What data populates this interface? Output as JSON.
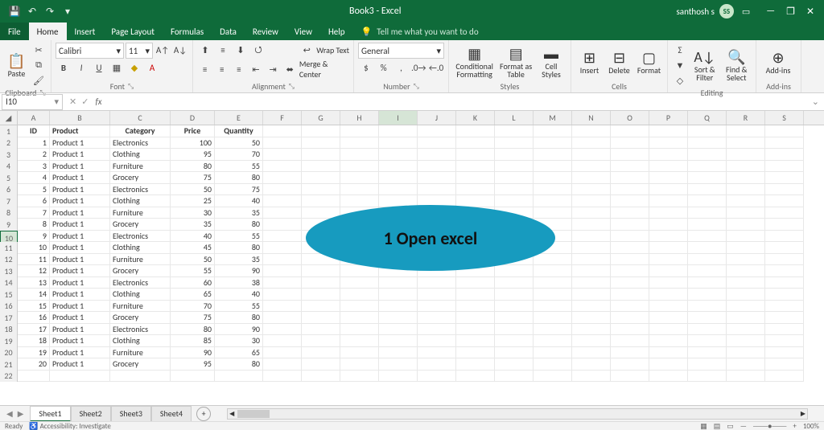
{
  "titlebar": {
    "title": "Book3 - Excel",
    "user_name": "santhosh s",
    "user_initials": "SS"
  },
  "tabs": {
    "file": "File",
    "items": [
      "Home",
      "Insert",
      "Page Layout",
      "Formulas",
      "Data",
      "Review",
      "View",
      "Help"
    ],
    "active": "Home",
    "tellme": "Tell me what you want to do"
  },
  "ribbon": {
    "clipboard": {
      "label": "Clipboard",
      "paste": "Paste"
    },
    "font": {
      "label": "Font",
      "font_name": "Calibri",
      "font_size": "11",
      "bold": "B",
      "italic": "I",
      "underline": "U"
    },
    "alignment": {
      "label": "Alignment",
      "wrap": "Wrap Text",
      "merge": "Merge & Center"
    },
    "number": {
      "label": "Number",
      "format": "General",
      "percent": "%",
      "comma": ","
    },
    "styles": {
      "label": "Styles",
      "conditional": "Conditional Formatting",
      "table": "Format as Table",
      "cell": "Cell Styles"
    },
    "cells": {
      "label": "Cells",
      "insert": "Insert",
      "delete": "Delete",
      "format": "Format"
    },
    "editing": {
      "label": "Editing",
      "sort": "Sort & Filter",
      "find": "Find & Select"
    },
    "addins": {
      "label": "Add-ins",
      "addins": "Add-ins"
    }
  },
  "formula_bar": {
    "name_box": "I10",
    "fx": "fx"
  },
  "columns": [
    "A",
    "B",
    "C",
    "D",
    "E",
    "F",
    "G",
    "H",
    "I",
    "J",
    "K",
    "L",
    "M",
    "N",
    "O",
    "P",
    "Q",
    "R",
    "S"
  ],
  "headers": {
    "a": "ID",
    "b": "Product",
    "c": "Category",
    "d": "Price",
    "e": "Quantity"
  },
  "rows": [
    {
      "n": 1,
      "id": 1,
      "product": "Product 1",
      "category": "Electronics",
      "price": 100,
      "qty": 50
    },
    {
      "n": 2,
      "id": 2,
      "product": "Product 1",
      "category": "Clothing",
      "price": 95,
      "qty": 70
    },
    {
      "n": 3,
      "id": 3,
      "product": "Product 1",
      "category": "Furniture",
      "price": 80,
      "qty": 55
    },
    {
      "n": 4,
      "id": 4,
      "product": "Product 1",
      "category": "Grocery",
      "price": 75,
      "qty": 80
    },
    {
      "n": 5,
      "id": 5,
      "product": "Product 1",
      "category": "Electronics",
      "price": 50,
      "qty": 75
    },
    {
      "n": 6,
      "id": 6,
      "product": "Product 1",
      "category": "Clothing",
      "price": 25,
      "qty": 40
    },
    {
      "n": 7,
      "id": 7,
      "product": "Product 1",
      "category": "Furniture",
      "price": 30,
      "qty": 35
    },
    {
      "n": 8,
      "id": 8,
      "product": "Product 1",
      "category": "Grocery",
      "price": 35,
      "qty": 80
    },
    {
      "n": 9,
      "id": 9,
      "product": "Product 1",
      "category": "Electronics",
      "price": 40,
      "qty": 55
    },
    {
      "n": 10,
      "id": 10,
      "product": "Product 1",
      "category": "Clothing",
      "price": 45,
      "qty": 80
    },
    {
      "n": 11,
      "id": 11,
      "product": "Product 1",
      "category": "Furniture",
      "price": 50,
      "qty": 35
    },
    {
      "n": 12,
      "id": 12,
      "product": "Product 1",
      "category": "Grocery",
      "price": 55,
      "qty": 90
    },
    {
      "n": 13,
      "id": 13,
      "product": "Product 1",
      "category": "Electronics",
      "price": 60,
      "qty": 38
    },
    {
      "n": 14,
      "id": 14,
      "product": "Product 1",
      "category": "Clothing",
      "price": 65,
      "qty": 40
    },
    {
      "n": 15,
      "id": 15,
      "product": "Product 1",
      "category": "Furniture",
      "price": 70,
      "qty": 55
    },
    {
      "n": 16,
      "id": 16,
      "product": "Product 1",
      "category": "Grocery",
      "price": 75,
      "qty": 80
    },
    {
      "n": 17,
      "id": 17,
      "product": "Product 1",
      "category": "Electronics",
      "price": 80,
      "qty": 90
    },
    {
      "n": 18,
      "id": 18,
      "product": "Product 1",
      "category": "Clothing",
      "price": 85,
      "qty": 30
    },
    {
      "n": 19,
      "id": 19,
      "product": "Product 1",
      "category": "Furniture",
      "price": 90,
      "qty": 65
    },
    {
      "n": 20,
      "id": 20,
      "product": "Product 1",
      "category": "Grocery",
      "price": 95,
      "qty": 80
    }
  ],
  "sheets": {
    "items": [
      "Sheet1",
      "Sheet2",
      "Sheet3",
      "Sheet4"
    ],
    "active": "Sheet1"
  },
  "status": {
    "ready": "Ready",
    "accessibility": "Accessibility: Investigate",
    "zoom": "100%"
  },
  "callout": "1 Open excel",
  "selected_cell": {
    "col": "I",
    "row": 10
  }
}
